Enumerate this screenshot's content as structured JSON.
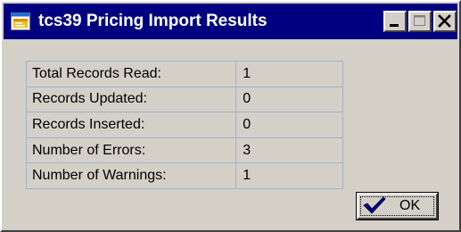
{
  "window": {
    "title": "tcs39 Pricing Import Results",
    "controls": {
      "minimize_icon": "minimize-icon",
      "maximize_icon": "maximize-icon",
      "close_icon": "close-icon"
    }
  },
  "results": {
    "rows": [
      {
        "label": "Total Records Read:",
        "value": "1"
      },
      {
        "label": "Records Updated:",
        "value": "0"
      },
      {
        "label": "Records Inserted:",
        "value": "0"
      },
      {
        "label": "Number of Errors:",
        "value": "3"
      },
      {
        "label": "Number of Warnings:",
        "value": "1"
      }
    ]
  },
  "ok_button": {
    "label": "OK",
    "icon": "checkmark-icon"
  },
  "colors": {
    "titlebar": "#000080",
    "face": "#d4d0c8",
    "grid": "#9db4c8",
    "check": "#000080"
  }
}
